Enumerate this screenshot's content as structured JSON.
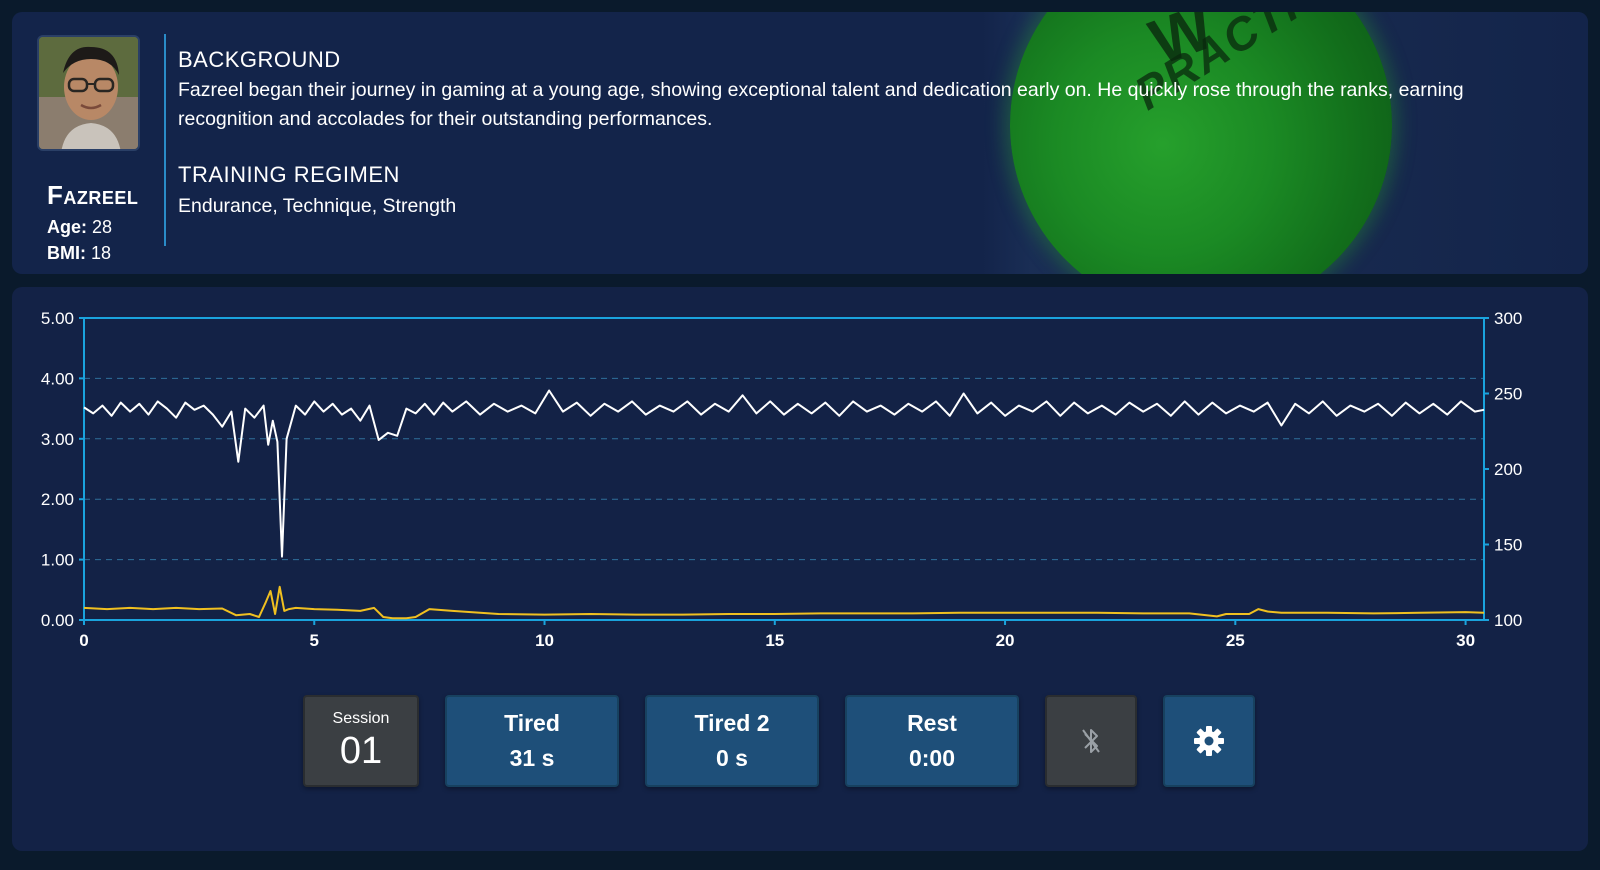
{
  "profile": {
    "name": "Fazreel",
    "age_label": "Age:",
    "age": "28",
    "bmi_label": "BMI:",
    "bmi": "18",
    "background_title": "BACKGROUND",
    "background_text": "Fazreel began their journey in gaming at a young age, showing exceptional talent and dedication early on. He quickly rose through the ranks, earning recognition and accolades for their outstanding performances.",
    "training_title": "TRAINING REGIMEN",
    "training_text": "Endurance, Technique, Strength",
    "ball_logo_text": "PRACTICE"
  },
  "chart_data": {
    "type": "line",
    "x_ticks": [
      "0",
      "5",
      "10",
      "15",
      "20",
      "25",
      "30"
    ],
    "xlim": [
      0,
      30.4
    ],
    "y_left_ticks": [
      "0.00",
      "1.00",
      "2.00",
      "3.00",
      "4.00",
      "5.00"
    ],
    "ylim_left": [
      0,
      5
    ],
    "y_right_ticks": [
      "100",
      "150",
      "200",
      "250",
      "300"
    ],
    "ylim_right": [
      100,
      300
    ],
    "grid": "horizontal dashed",
    "series": [
      {
        "color": "#ffffff",
        "axis": "left",
        "x": [
          0,
          0.2,
          0.4,
          0.6,
          0.8,
          1.0,
          1.2,
          1.4,
          1.6,
          1.8,
          2.0,
          2.2,
          2.4,
          2.6,
          2.8,
          3.0,
          3.2,
          3.35,
          3.5,
          3.7,
          3.9,
          4.0,
          4.1,
          4.2,
          4.3,
          4.4,
          4.6,
          4.8,
          5.0,
          5.2,
          5.4,
          5.6,
          5.8,
          6.0,
          6.2,
          6.4,
          6.6,
          6.8,
          7.0,
          7.2,
          7.4,
          7.6,
          7.8,
          8.0,
          8.3,
          8.6,
          8.9,
          9.2,
          9.5,
          9.8,
          10.1,
          10.4,
          10.7,
          11.0,
          11.3,
          11.6,
          11.9,
          12.2,
          12.5,
          12.8,
          13.1,
          13.4,
          13.7,
          14.0,
          14.3,
          14.6,
          14.9,
          15.2,
          15.5,
          15.8,
          16.1,
          16.4,
          16.7,
          17.0,
          17.3,
          17.6,
          17.9,
          18.2,
          18.5,
          18.8,
          19.1,
          19.4,
          19.7,
          20.0,
          20.3,
          20.6,
          20.9,
          21.2,
          21.5,
          21.8,
          22.1,
          22.4,
          22.7,
          23.0,
          23.3,
          23.6,
          23.9,
          24.2,
          24.5,
          24.8,
          25.1,
          25.4,
          25.7,
          26.0,
          26.3,
          26.6,
          26.9,
          27.2,
          27.5,
          27.8,
          28.1,
          28.4,
          28.7,
          29.0,
          29.3,
          29.6,
          29.9,
          30.2,
          30.4
        ],
        "values": [
          3.52,
          3.42,
          3.55,
          3.38,
          3.6,
          3.45,
          3.58,
          3.4,
          3.62,
          3.5,
          3.35,
          3.6,
          3.48,
          3.55,
          3.4,
          3.2,
          3.45,
          2.62,
          3.5,
          3.35,
          3.55,
          2.9,
          3.3,
          2.95,
          1.05,
          3.0,
          3.55,
          3.4,
          3.62,
          3.45,
          3.58,
          3.4,
          3.5,
          3.3,
          3.55,
          2.98,
          3.1,
          3.05,
          3.5,
          3.42,
          3.58,
          3.4,
          3.6,
          3.45,
          3.62,
          3.4,
          3.58,
          3.45,
          3.55,
          3.42,
          3.8,
          3.45,
          3.6,
          3.38,
          3.58,
          3.45,
          3.62,
          3.4,
          3.55,
          3.45,
          3.62,
          3.4,
          3.58,
          3.45,
          3.72,
          3.42,
          3.62,
          3.4,
          3.58,
          3.42,
          3.6,
          3.38,
          3.62,
          3.45,
          3.55,
          3.4,
          3.58,
          3.45,
          3.62,
          3.38,
          3.75,
          3.42,
          3.6,
          3.38,
          3.55,
          3.45,
          3.62,
          3.38,
          3.6,
          3.42,
          3.55,
          3.4,
          3.6,
          3.45,
          3.58,
          3.38,
          3.62,
          3.4,
          3.6,
          3.42,
          3.55,
          3.45,
          3.6,
          3.22,
          3.58,
          3.42,
          3.62,
          3.38,
          3.55,
          3.45,
          3.58,
          3.38,
          3.6,
          3.42,
          3.58,
          3.4,
          3.62,
          3.45,
          3.48
        ]
      },
      {
        "color": "#f0c020",
        "axis": "left",
        "x": [
          0,
          0.5,
          1.0,
          1.5,
          2.0,
          2.5,
          3.0,
          3.3,
          3.6,
          3.8,
          3.95,
          4.05,
          4.15,
          4.25,
          4.35,
          4.45,
          4.6,
          5.0,
          5.5,
          6.0,
          6.3,
          6.5,
          6.7,
          7.0,
          7.2,
          7.5,
          8.0,
          9.0,
          10.0,
          11.0,
          12.0,
          13.0,
          14.0,
          15.0,
          16.0,
          17.0,
          18.0,
          19.0,
          20.0,
          21.0,
          22.0,
          23.0,
          24.0,
          24.6,
          24.8,
          25.0,
          25.3,
          25.5,
          25.7,
          26.0,
          27.0,
          28.0,
          29.0,
          30.0,
          30.4
        ],
        "values": [
          0.2,
          0.18,
          0.2,
          0.18,
          0.2,
          0.18,
          0.19,
          0.08,
          0.1,
          0.05,
          0.3,
          0.48,
          0.1,
          0.55,
          0.15,
          0.18,
          0.2,
          0.18,
          0.17,
          0.15,
          0.2,
          0.05,
          0.03,
          0.03,
          0.05,
          0.18,
          0.15,
          0.1,
          0.09,
          0.1,
          0.09,
          0.09,
          0.1,
          0.1,
          0.11,
          0.11,
          0.11,
          0.12,
          0.12,
          0.12,
          0.12,
          0.11,
          0.11,
          0.06,
          0.1,
          0.1,
          0.1,
          0.18,
          0.14,
          0.12,
          0.12,
          0.11,
          0.12,
          0.13,
          0.12
        ]
      }
    ]
  },
  "controls": {
    "session_label": "Session",
    "session_value": "01",
    "tired_label": "Tired",
    "tired_value": "31 s",
    "tired2_label": "Tired 2",
    "tired2_value": "0 s",
    "rest_label": "Rest",
    "rest_value": "0:00",
    "bluetooth_icon": "bluetooth-disabled-icon",
    "settings_icon": "gear-icon"
  }
}
